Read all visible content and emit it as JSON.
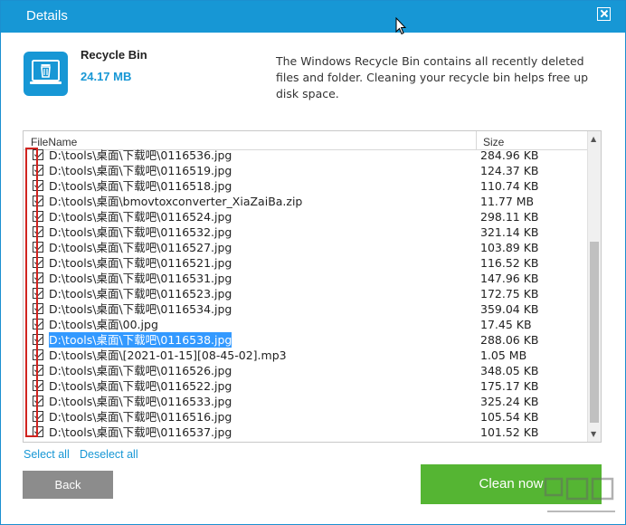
{
  "window": {
    "title": "Details"
  },
  "info": {
    "title": "Recycle Bin",
    "size": "24.17 MB",
    "description": "The Windows Recycle Bin contains all recently deleted files and folder. Cleaning your recycle bin helps free up disk space."
  },
  "list": {
    "header_file": "FileName",
    "header_size": "Size",
    "rows": [
      {
        "name": "D:\\tools\\桌面\\下载吧\\0116536.jpg",
        "size": "284.96 KB"
      },
      {
        "name": "D:\\tools\\桌面\\下载吧\\0116519.jpg",
        "size": "124.37 KB"
      },
      {
        "name": "D:\\tools\\桌面\\下载吧\\0116518.jpg",
        "size": "110.74 KB"
      },
      {
        "name": "D:\\tools\\桌面\\bmovtoxconverter_XiaZaiBa.zip",
        "size": "11.77 MB"
      },
      {
        "name": "D:\\tools\\桌面\\下载吧\\0116524.jpg",
        "size": "298.11 KB"
      },
      {
        "name": "D:\\tools\\桌面\\下载吧\\0116532.jpg",
        "size": "321.14 KB"
      },
      {
        "name": "D:\\tools\\桌面\\下载吧\\0116527.jpg",
        "size": "103.89 KB"
      },
      {
        "name": "D:\\tools\\桌面\\下载吧\\0116521.jpg",
        "size": "116.52 KB"
      },
      {
        "name": "D:\\tools\\桌面\\下载吧\\0116531.jpg",
        "size": "147.96 KB"
      },
      {
        "name": "D:\\tools\\桌面\\下载吧\\0116523.jpg",
        "size": "172.75 KB"
      },
      {
        "name": "D:\\tools\\桌面\\下载吧\\0116534.jpg",
        "size": "359.04 KB"
      },
      {
        "name": "D:\\tools\\桌面\\00.jpg",
        "size": "17.45 KB"
      },
      {
        "name": "D:\\tools\\桌面\\下载吧\\0116538.jpg",
        "size": "288.06 KB",
        "selected": true
      },
      {
        "name": "D:\\tools\\桌面\\[2021-01-15][08-45-02].mp3",
        "size": "1.05 MB"
      },
      {
        "name": "D:\\tools\\桌面\\下载吧\\0116526.jpg",
        "size": "348.05 KB"
      },
      {
        "name": "D:\\tools\\桌面\\下载吧\\0116522.jpg",
        "size": "175.17 KB"
      },
      {
        "name": "D:\\tools\\桌面\\下载吧\\0116533.jpg",
        "size": "325.24 KB"
      },
      {
        "name": "D:\\tools\\桌面\\下载吧\\0116516.jpg",
        "size": "105.54 KB"
      },
      {
        "name": "D:\\tools\\桌面\\下载吧\\0116537.jpg",
        "size": "101.52 KB"
      }
    ]
  },
  "actions": {
    "select_all": "Select all",
    "deselect_all": "Deselect all",
    "back": "Back",
    "clean_now": "Clean now"
  },
  "colors": {
    "accent": "#1797d5",
    "clean_button": "#55b533",
    "back_button": "#8c8c8c",
    "highlight": "#d0231f"
  },
  "icons": {
    "app": "recycle-bin-icon",
    "close": "close-icon",
    "checkbox": "checkbox-checked-icon"
  }
}
